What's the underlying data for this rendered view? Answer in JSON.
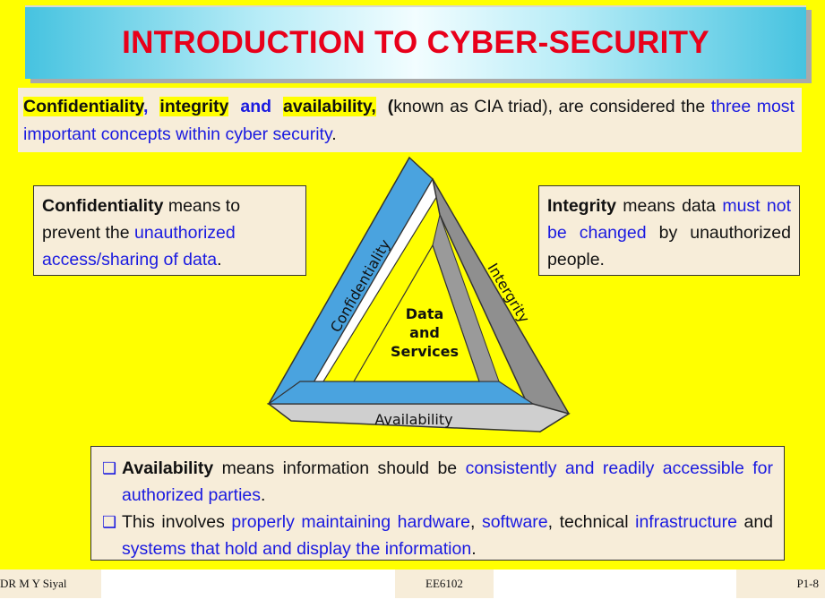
{
  "title": "INTRODUCTION TO CYBER-SECURITY",
  "intro": {
    "confidentiality": "Confidentiality",
    "comma1": ",",
    "integrity": "integrity",
    "and": "and",
    "availability": "availability,",
    "paren": "(",
    "known_as": "known as  CIA triad), are considered the ",
    "highlight_phrase": "three most important concepts within cyber security",
    "end": "."
  },
  "confidentiality_box": {
    "term": "Confidentiality",
    "text1": " means to prevent the ",
    "highlight": "unauthorized access/sharing of data",
    "end": "."
  },
  "integrity_box": {
    "term": "Integrity",
    "text1": " means data ",
    "highlight": "must not be changed",
    "text2": " by unauthorized people."
  },
  "triangle": {
    "left_label": "Confidentiality",
    "right_label": "Intergrity",
    "bottom_label": "Availability",
    "center_line1": "Data",
    "center_line2": "and",
    "center_line3": "Services",
    "colors": {
      "left": "#4aa3df",
      "right": "#8f8f8f",
      "bottom": "#cfcfcf",
      "inner": "#ffff00"
    }
  },
  "availability_box": {
    "bullet1": {
      "term": "Availability",
      "text1": " means information should be ",
      "highlight": "consistently and readily accessible for authorized parties",
      "end": "."
    },
    "bullet2": {
      "text1": "This involves ",
      "h1": "properly maintaining hardware",
      "c1": ", ",
      "h2": "software",
      "text2": ", technical ",
      "h3": "infrastructure",
      "text3": " and ",
      "h4": "systems that hold and display the information",
      "end": "."
    }
  },
  "footer": {
    "left": "DR M Y Siyal",
    "center": "EE6102",
    "right": "P1-8"
  }
}
